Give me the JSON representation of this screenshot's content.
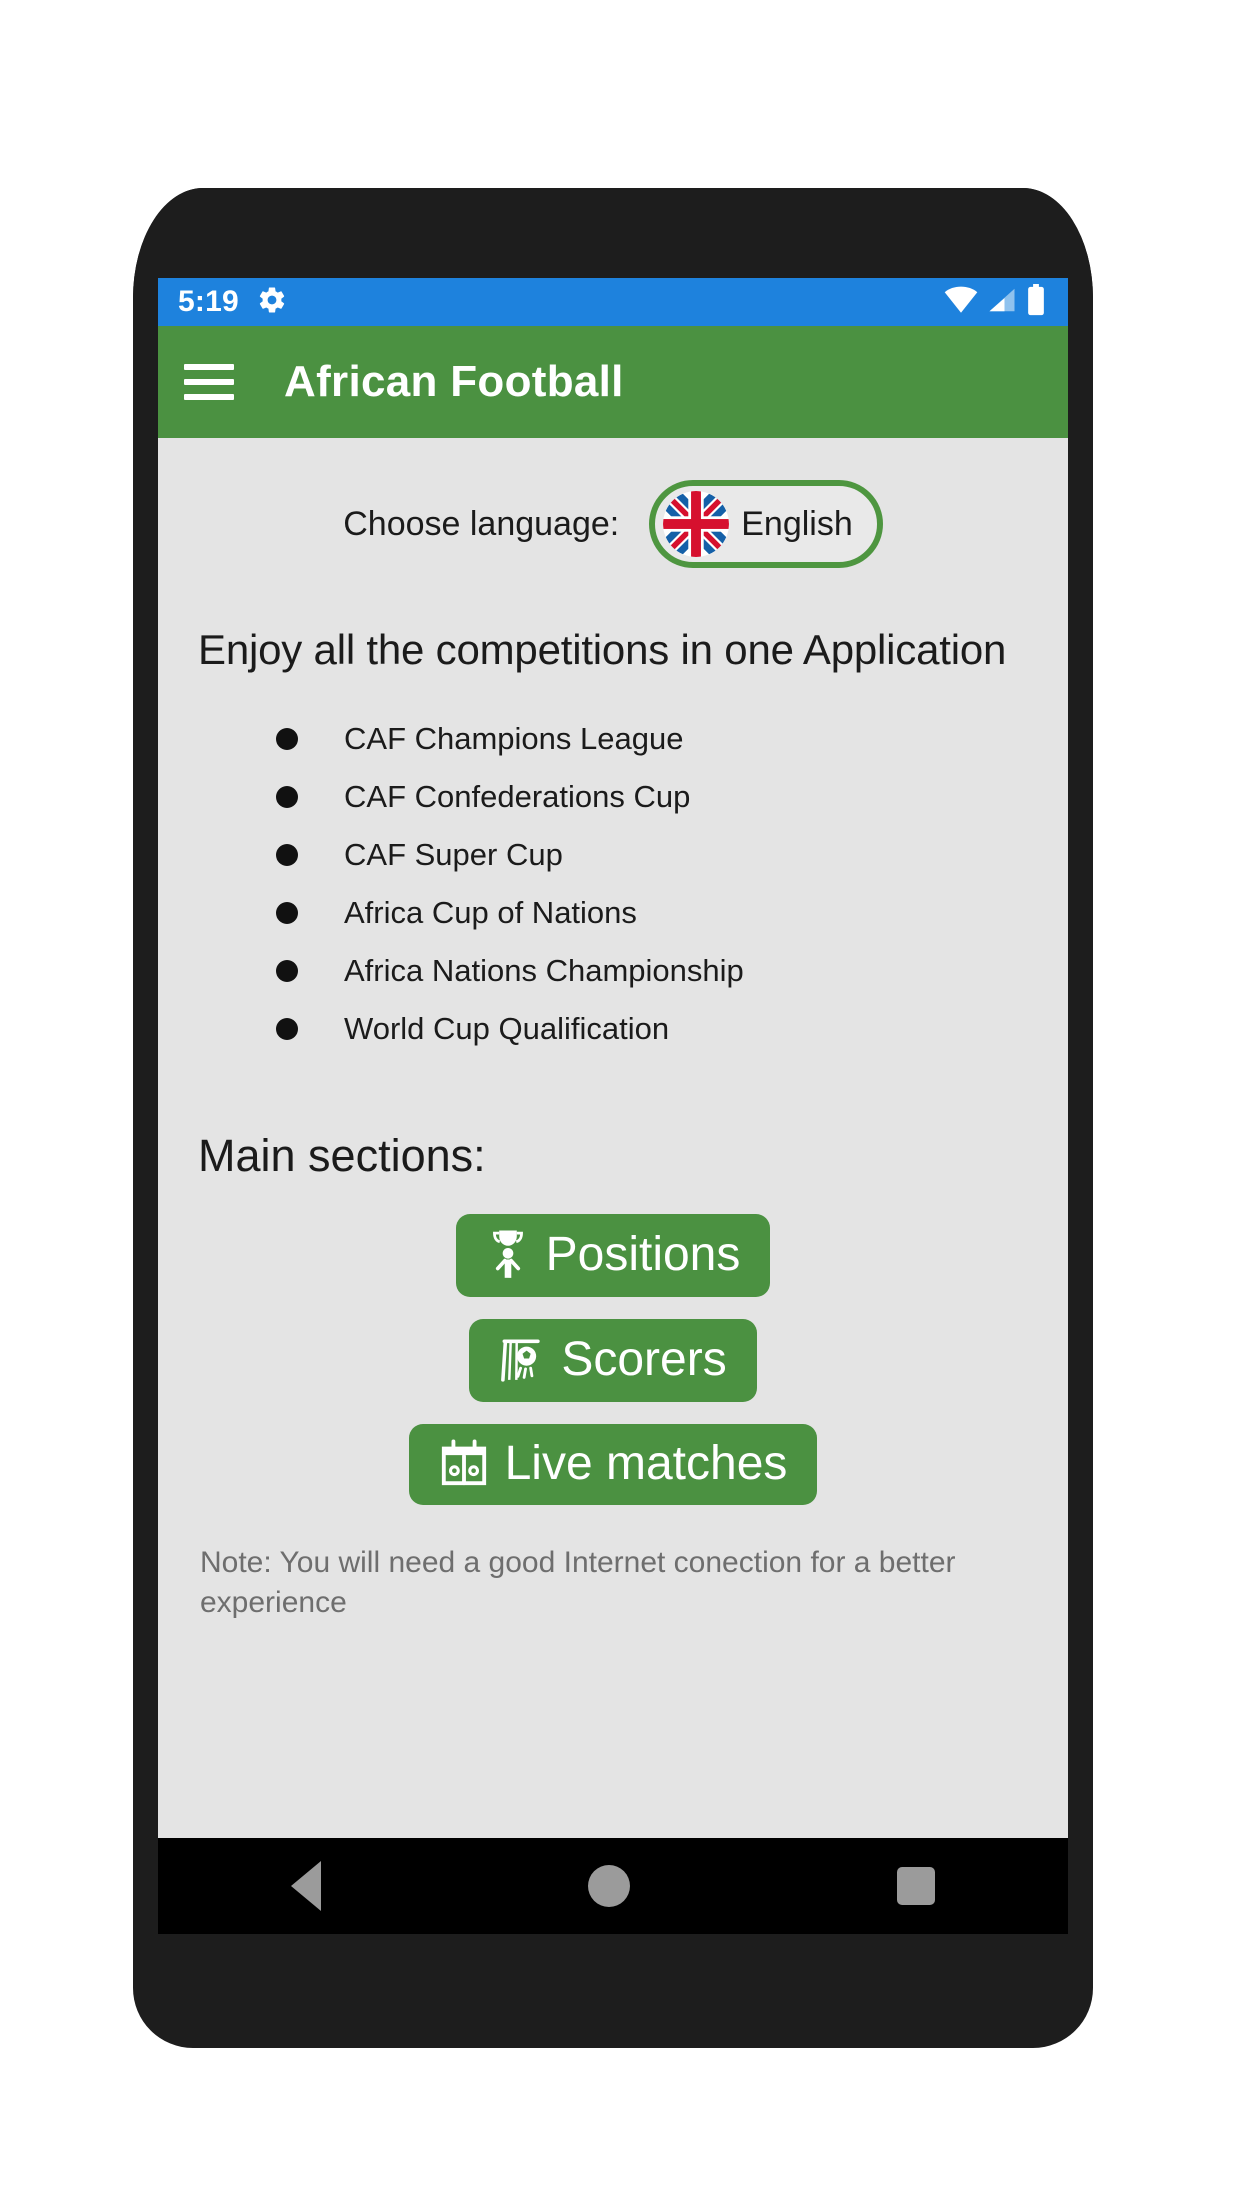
{
  "status_bar": {
    "time": "5:19",
    "gear_icon": "gear-icon",
    "wifi_icon": "wifi-icon",
    "signal_icon": "cell-signal-icon",
    "battery_icon": "battery-full-icon"
  },
  "app_bar": {
    "menu_icon": "hamburger-menu-icon",
    "title": "African Football"
  },
  "language": {
    "label": "Choose language:",
    "selected": "English",
    "flag_icon": "uk-flag-icon"
  },
  "headline": "Enjoy all the competitions in one Application",
  "competitions": [
    "CAF Champions League",
    "CAF Confederations Cup",
    "CAF Super Cup",
    "Africa Cup of Nations",
    "Africa Nations Championship",
    "World Cup Qualification"
  ],
  "sections": {
    "title": "Main sections:",
    "buttons": [
      {
        "label": "Positions",
        "icon": "trophy-podium-icon"
      },
      {
        "label": "Scorers",
        "icon": "goal-net-ball-icon"
      },
      {
        "label": "Live matches",
        "icon": "calendar-icon"
      }
    ]
  },
  "note": "Note: You will need a good Internet conection for a better experience",
  "nav_bar": {
    "back_icon": "back-triangle-icon",
    "home_icon": "home-circle-icon",
    "recents_icon": "recents-square-icon"
  },
  "colors": {
    "status_bar": "#1e82dd",
    "app_bar_green": "#4b9141",
    "screen_bg": "#e4e4e4",
    "phone_body": "#1d1d1d",
    "note_gray": "#6e6e6e"
  }
}
